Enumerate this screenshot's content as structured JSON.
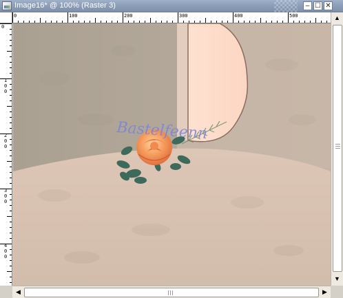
{
  "window": {
    "title": "Image16* @ 100% (Raster 3)",
    "minimize_glyph": "–",
    "maximize_glyph": "☐",
    "close_glyph": "✕"
  },
  "rulers": {
    "horizontal_labels": [
      "0",
      "100",
      "200",
      "300",
      "400",
      "500"
    ],
    "vertical_labels": [
      "0",
      "100",
      "200",
      "300",
      "400"
    ]
  },
  "canvas": {
    "watermark_text": "Bastelfeenn",
    "colors": {
      "upper_background": "#b7ab9c",
      "floor": "#d9c3b2",
      "panel": "#ffdbc9",
      "watermark": "#7b84d8",
      "rose": "#f4935c"
    }
  },
  "scrollbars": {
    "up_arrow": "▲",
    "down_arrow": "▼",
    "left_arrow": "◀",
    "right_arrow": "▶"
  }
}
